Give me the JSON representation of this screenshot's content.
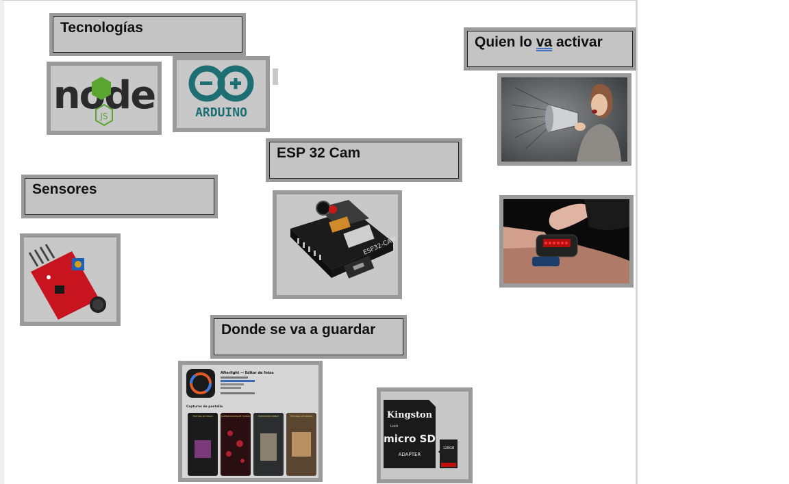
{
  "labels": {
    "tecnologias": "Tecnologías",
    "quien_pre": "Quien lo ",
    "quien_word": "va",
    "quien_post": " activar",
    "esp32": "ESP 32 Cam",
    "sensores": "Sensores",
    "donde": "Donde se va a guardar"
  },
  "images": {
    "nodejs": {
      "wordmark": "node",
      "badge": "JS"
    },
    "arduino": {
      "wordmark": "ARDUINO"
    },
    "esp32_board": {
      "silk": "ESP32-CAM"
    },
    "sd_card": {
      "brand": "Kingston",
      "logo": "micro SD",
      "adapter": "ADAPTER",
      "lock": "Lock",
      "capacity": "128GB"
    },
    "app_store": {
      "app_title": "Afterlight — Editor de fotos",
      "section": "Capturas de pantalla",
      "screens": [
        "TEXTURA DE POLVO",
        "SUPERPOSICIÓN DE FILTROS",
        "EXPOSICIÓN DOBLE",
        "TEXTURAS DE PRISMA"
      ]
    }
  },
  "colors": {
    "frame": "#9a9a9a",
    "fill": "#c4c4c4",
    "arduino_teal": "#1d6f73",
    "node_green": "#5aa431",
    "sensor_red": "#c8141e",
    "underline_blue": "#4472c4"
  }
}
